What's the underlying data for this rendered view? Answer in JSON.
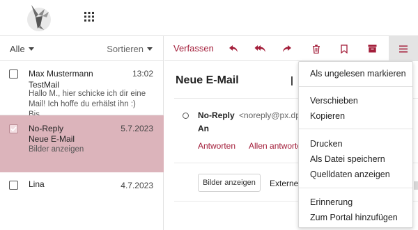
{
  "app": {
    "logo_icon": "bird-logo-icon",
    "apps_icon": "app-grid-icon"
  },
  "list": {
    "filter_label": "Alle",
    "sort_label": "Sortieren",
    "messages": [
      {
        "from": "Max Mustermann",
        "date": "13:02",
        "subject": "TestMail",
        "preview": "Hallo M., hier schicke ich dir eine Mail! Ich hoffe du erhälst ihn :) Bis...",
        "checked": false
      },
      {
        "from": "No-Reply",
        "date": "5.7.2023",
        "subject": "Neue E-Mail",
        "preview": "Bilder anzeigen",
        "checked": true
      },
      {
        "from": "Lina",
        "date": "4.7.2023",
        "subject": "",
        "preview": "",
        "checked": false
      }
    ]
  },
  "toolbar": {
    "compose_label": "Verfassen",
    "icons": [
      "reply-icon",
      "reply-all-icon",
      "forward-icon",
      "delete-icon",
      "bookmark-icon",
      "archive-icon",
      "menu-icon"
    ],
    "accent_color": "#a31e3a"
  },
  "reading": {
    "title": "Neue E-Mail",
    "sender_name": "No-Reply",
    "sender_email": "<noreply@px.dp",
    "to_label": "An",
    "reply_label": "Antworten",
    "reply_all_label": "Allen antworte",
    "show_images_label": "Bilder anzeigen",
    "external_label": "Externe"
  },
  "menu": {
    "groups": [
      [
        "Als ungelesen markieren"
      ],
      [
        "Verschieben",
        "Kopieren"
      ],
      [
        "Drucken",
        "Als Datei speichern",
        "Quelldaten anzeigen"
      ],
      [
        "Erinnerung",
        "Zum Portal hinzufügen"
      ]
    ]
  },
  "colors": {
    "selected_row": "#dcb4bb",
    "accent": "#a31e3a"
  }
}
